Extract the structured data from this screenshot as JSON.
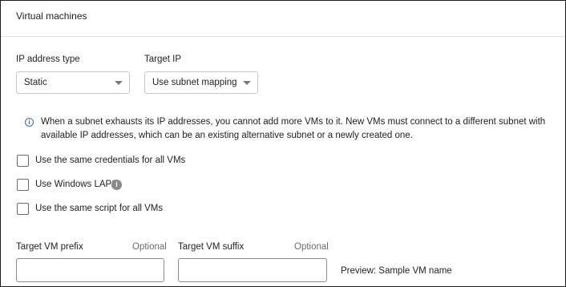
{
  "section": {
    "title": "Virtual machines"
  },
  "ip_address_type": {
    "label": "IP address type",
    "value": "Static"
  },
  "target_ip": {
    "label": "Target IP",
    "value": "Use subnet mapping"
  },
  "info": {
    "icon": "info-icon",
    "text": "When a subnet exhausts its IP addresses, you cannot add more VMs to it. New VMs must connect to a different subnet with available IP addresses, which can be an existing alternative subnet or a newly created one."
  },
  "checkboxes": [
    {
      "label": "Use the same credentials for all VMs",
      "checked": false
    },
    {
      "label": "Use Windows LAPS",
      "checked": false,
      "help_icon": "help-icon"
    },
    {
      "label": "Use the same script for all VMs",
      "checked": false
    }
  ],
  "vm_prefix": {
    "label": "Target VM prefix",
    "optional": "Optional",
    "value": ""
  },
  "vm_suffix": {
    "label": "Target VM suffix",
    "optional": "Optional",
    "value": ""
  },
  "preview": {
    "text": "Preview: Sample VM name"
  },
  "colors": {
    "accent": "#2f6bd9",
    "border": "#8c8c8c",
    "muted": "#6d6d6d"
  }
}
